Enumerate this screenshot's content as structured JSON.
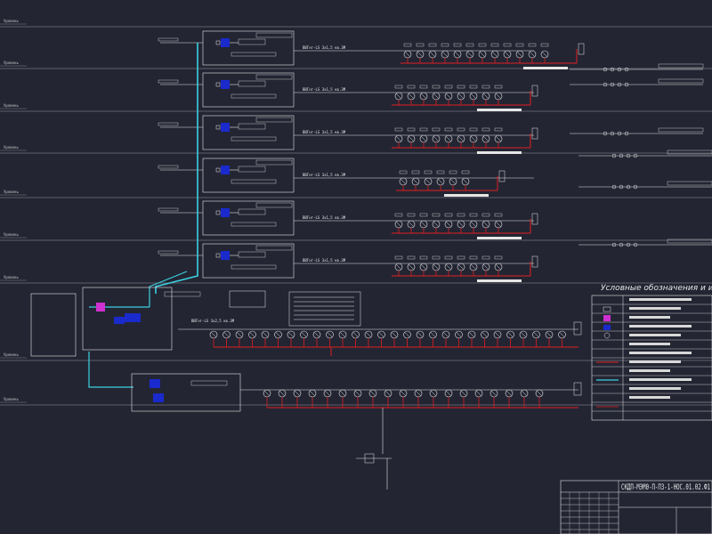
{
  "drawing": {
    "stamp_code": "СКДП-МЭМ0-П-ПЗ-1-НОС.01.02.Ф1",
    "legend_title": "Условные обозначения и изображения",
    "level_labels": [
      "Уровень",
      "Уровень",
      "Уровень",
      "Уровень",
      "Уровень",
      "Уровень",
      "Уровень",
      "Уровень",
      "Уровень"
    ],
    "floor_cable_label": "ВВГнг-LS 3х1,5 кв.3М",
    "main_cable_label": "ВВГнг-LS 3х2,5 кв.3М"
  },
  "colors": {
    "background": "#232533",
    "line_white": "#e6e6e6",
    "line_red": "#e02020",
    "line_cyan": "#3cd0e0",
    "device_blue": "#1a2acc",
    "device_magenta": "#d030d0"
  }
}
